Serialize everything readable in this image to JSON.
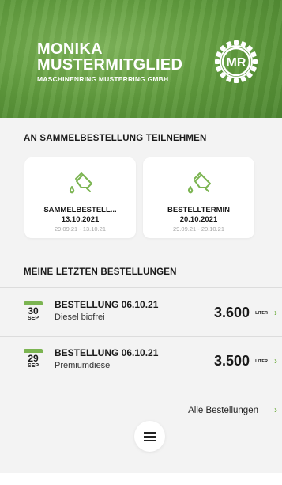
{
  "header": {
    "name": "MONIKA MUSTERMITGLIED",
    "company": "MASCHINENRING MUSTERRING GMBH",
    "logo_text": "MR"
  },
  "join_section": {
    "title": "AN SAMMELBESTELLUNG TEILNEHMEN",
    "cards": [
      {
        "icon": "fuel-nozzle-icon",
        "title": "SAMMELBESTELL...",
        "date": "13.10.2021",
        "range": "29.09.21 - 13.10.21"
      },
      {
        "icon": "fuel-nozzle-icon",
        "title": "BESTELLTERMIN",
        "date": "20.10.2021",
        "range": "29.09.21 - 20.10.21"
      }
    ]
  },
  "orders_section": {
    "title": "MEINE LETZTEN BESTELLUNGEN",
    "orders": [
      {
        "day": "30",
        "month": "SEP",
        "title": "BESTELLUNG 06.10.21",
        "product": "Diesel biofrei",
        "amount": "3.600",
        "unit": "LITER"
      },
      {
        "day": "29",
        "month": "SEP",
        "title": "BESTELLUNG 06.10.21",
        "product": "Premiumdiesel",
        "amount": "3.500",
        "unit": "LITER"
      }
    ],
    "all_link": "Alle Bestellungen"
  },
  "colors": {
    "accent": "#7bb451",
    "header_green": "#5f9a3c"
  }
}
